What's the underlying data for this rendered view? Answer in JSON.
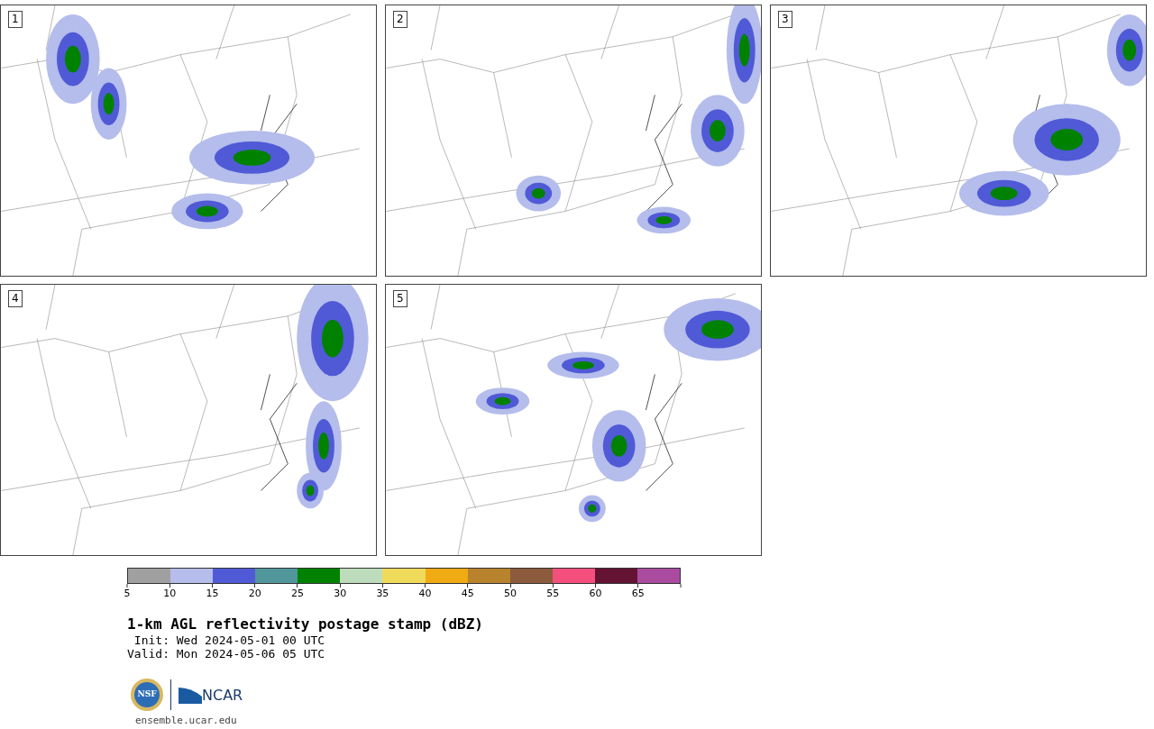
{
  "panels": [
    {
      "label": "1"
    },
    {
      "label": "2"
    },
    {
      "label": "3"
    },
    {
      "label": "4"
    },
    {
      "label": "5"
    }
  ],
  "colorbar": {
    "segments": [
      {
        "color": "#a0a0a0"
      },
      {
        "color": "#b4bdeb"
      },
      {
        "color": "#505ad7"
      },
      {
        "color": "#50969b"
      },
      {
        "color": "#008200"
      },
      {
        "color": "#bcdcbc"
      },
      {
        "color": "#f0da5a"
      },
      {
        "color": "#f0aa14"
      },
      {
        "color": "#b9822d"
      },
      {
        "color": "#8c5a3c"
      },
      {
        "color": "#f5507d"
      },
      {
        "color": "#641432"
      },
      {
        "color": "#aa4ba0"
      }
    ],
    "ticks": [
      "5",
      "10",
      "15",
      "20",
      "25",
      "30",
      "35",
      "40",
      "45",
      "50",
      "55",
      "60",
      "65"
    ]
  },
  "title": "1-km AGL reflectivity postage stamp (dBZ)",
  "init": " Init: Wed 2024-05-01 00 UTC",
  "valid": "Valid: Mon 2024-05-06 05 UTC",
  "logos": {
    "nsf": "NSF",
    "ncar": "NCAR"
  },
  "url": "ensemble.ucar.edu"
}
